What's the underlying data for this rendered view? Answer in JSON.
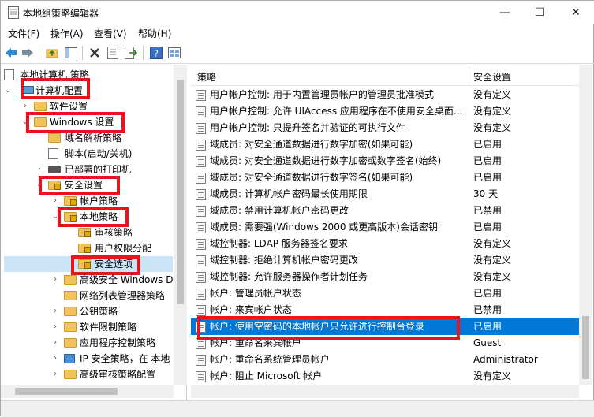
{
  "window": {
    "title": "本地组策略编辑器",
    "minimize": "—",
    "maximize": "☐",
    "close": "✕"
  },
  "menu": [
    "文件(F)",
    "操作(A)",
    "查看(V)",
    "帮助(H)"
  ],
  "toolbar": [
    "back-icon",
    "forward-icon",
    "up-folder-icon",
    "show-hide-tree-icon",
    "delete-icon",
    "properties-icon",
    "export-list-icon",
    "help-icon",
    "view-icon"
  ],
  "tree": [
    {
      "label": "本地计算机 策略",
      "icon": "policy-icon"
    },
    {
      "label": "计算机配置",
      "icon": "computer-icon",
      "expanded": true
    },
    {
      "label": "软件设置",
      "icon": "folder-icon"
    },
    {
      "label": "Windows 设置",
      "icon": "folder-icon",
      "expanded": true
    },
    {
      "label": "域名解析策略",
      "icon": "folder-icon"
    },
    {
      "label": "脚本(启动/关机)",
      "icon": "script-icon"
    },
    {
      "label": "已部署的打印机",
      "icon": "printer-icon"
    },
    {
      "label": "安全设置",
      "icon": "security-folder-icon",
      "expanded": true
    },
    {
      "label": "帐户策略",
      "icon": "lock-folder-icon"
    },
    {
      "label": "本地策略",
      "icon": "lock-folder-icon",
      "expanded": true
    },
    {
      "label": "审核策略",
      "icon": "lock-folder-icon"
    },
    {
      "label": "用户权限分配",
      "icon": "lock-folder-icon"
    },
    {
      "label": "安全选项",
      "icon": "lock-folder-icon",
      "selected": true
    },
    {
      "label": "高级安全 Windows D",
      "icon": "folder-icon"
    },
    {
      "label": "网络列表管理器策略",
      "icon": "folder-icon"
    },
    {
      "label": "公钥策略",
      "icon": "folder-icon"
    },
    {
      "label": "软件限制策略",
      "icon": "folder-icon"
    },
    {
      "label": "应用程序控制策略",
      "icon": "folder-icon"
    },
    {
      "label": "IP 安全策略，在 本地",
      "icon": "ip-security-icon"
    },
    {
      "label": "高级审核策略配置",
      "icon": "folder-icon"
    }
  ],
  "list": {
    "columns": {
      "policy": "策略",
      "setting": "安全设置"
    },
    "rows": [
      {
        "policy": "用户帐户控制: 用于内置管理员帐户的管理员批准模式",
        "setting": "没有定义"
      },
      {
        "policy": "用户帐户控制: 允许 UIAccess 应用程序在不使用安全桌面...",
        "setting": "没有定义"
      },
      {
        "policy": "用户帐户控制: 只提升签名并验证的可执行文件",
        "setting": "没有定义"
      },
      {
        "policy": "域成员: 对安全通道数据进行数字加密(如果可能)",
        "setting": "已启用"
      },
      {
        "policy": "域成员: 对安全通道数据进行数字加密或数字签名(始终)",
        "setting": "已启用"
      },
      {
        "policy": "域成员: 对安全通道数据进行数字签名(如果可能)",
        "setting": "已启用"
      },
      {
        "policy": "域成员: 计算机帐户密码最长使用期限",
        "setting": "30 天"
      },
      {
        "policy": "域成员: 禁用计算机帐户密码更改",
        "setting": "已禁用"
      },
      {
        "policy": "域成员: 需要强(Windows 2000 或更高版本)会话密钥",
        "setting": "已启用"
      },
      {
        "policy": "域控制器: LDAP 服务器签名要求",
        "setting": "没有定义"
      },
      {
        "policy": "域控制器: 拒绝计算机帐户密码更改",
        "setting": "没有定义"
      },
      {
        "policy": "域控制器: 允许服务器操作者计划任务",
        "setting": "没有定义"
      },
      {
        "policy": "帐户: 管理员帐户状态",
        "setting": "已启用"
      },
      {
        "policy": "帐户: 来宾帐户状态",
        "setting": "已禁用"
      },
      {
        "policy": "帐户: 使用空密码的本地帐户只允许进行控制台登录",
        "setting": "已启用",
        "selected": true
      },
      {
        "policy": "帐户: 重命名来宾帐户",
        "setting": "Guest"
      },
      {
        "policy": "帐户: 重命名系统管理员帐户",
        "setting": "Administrator"
      },
      {
        "policy": "帐户: 阻止 Microsoft 帐户",
        "setting": "没有定义"
      }
    ]
  },
  "colors": {
    "selection": "#0078d7",
    "annotation": "#e8141d",
    "folder": "#f2c35a"
  }
}
